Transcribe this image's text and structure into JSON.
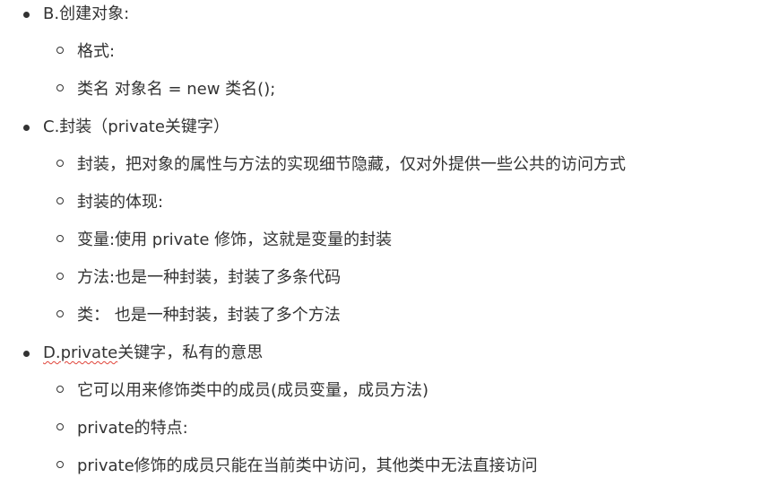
{
  "sections": [
    {
      "title": "B.创建对象:",
      "items": [
        "格式:",
        "类名 对象名 = new 类名();"
      ]
    },
    {
      "title": "C.封装（private关键字）",
      "items": [
        "封装，把对象的属性与方法的实现细节隐藏，仅对外提供一些公共的访问方式",
        "封装的体现:",
        "变量:使用 private 修饰，这就是变量的封装",
        "方法:也是一种封装，封装了多条代码",
        "类： 也是一种封装，封装了多个方法"
      ]
    },
    {
      "title_spellchecked": "D.private",
      "title_rest": "关键字，私有的意思",
      "items": [
        "它可以用来修饰类中的成员(成员变量，成员方法)",
        "private的特点:",
        "private修饰的成员只能在当前类中访问，其他类中无法直接访问"
      ]
    }
  ]
}
